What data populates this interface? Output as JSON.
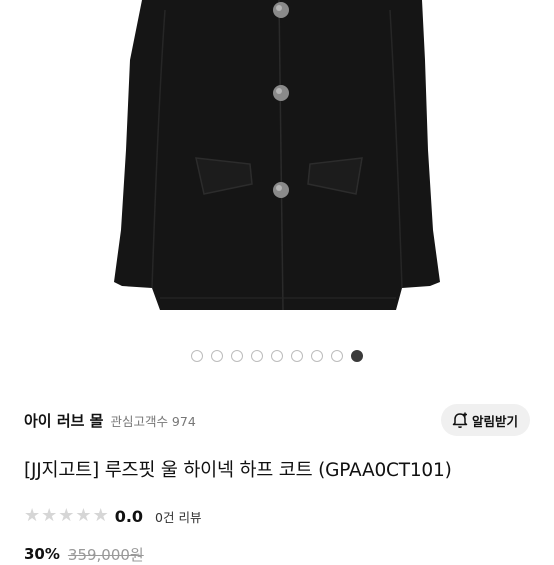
{
  "colors": {
    "coat": "#151515",
    "button": "#8a8a8a",
    "pager_active": "#3a3a3a",
    "chip_bg": "#f0f0f0",
    "star_empty": "#d6d6d6"
  },
  "gallery": {
    "total_images": 9,
    "active_index": 8
  },
  "store": {
    "name": "아이 러브 몰",
    "followers_label": "관심고객수 974",
    "alert_icon": "bell-plus-icon",
    "alert_button_label": "알림받기"
  },
  "product": {
    "title": "[JJ지고트] 루즈핏 울 하이넥 하프 코트 (GPAA0CT101)",
    "rating_score": 0.0,
    "rating_value": "0.0",
    "review_count_label": "0건 리뷰",
    "discount_label": "30%",
    "original_price": "359,000원"
  }
}
